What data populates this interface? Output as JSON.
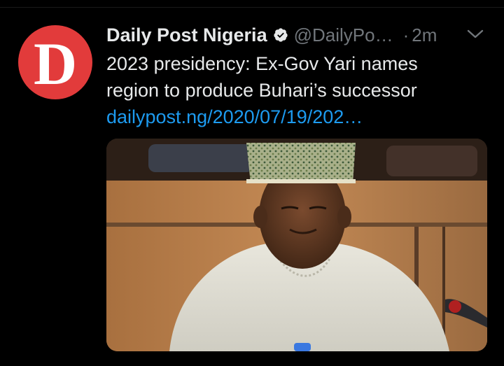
{
  "tweet": {
    "author": {
      "display_name": "Daily Post Nigeria",
      "handle": "@DailyPo…",
      "avatar_letter": "D",
      "avatar_color": "#e23b3b",
      "verified": true
    },
    "separator": "·",
    "timestamp": "2m",
    "text_line_1": "2023 presidency: Ex-Gov Yari names",
    "text_line_2": "region to produce Buhari’s successor",
    "link_text": "dailypost.ng/2020/07/19/202…",
    "media": {
      "type": "photo"
    }
  },
  "colors": {
    "background": "#000000",
    "primary_text": "#e7e9ea",
    "secondary_text": "#71767b",
    "link": "#1d9bf0",
    "verified_badge": "#e7e9ea"
  },
  "icons": {
    "verified": "verified-badge-icon",
    "more": "chevron-down-icon"
  }
}
